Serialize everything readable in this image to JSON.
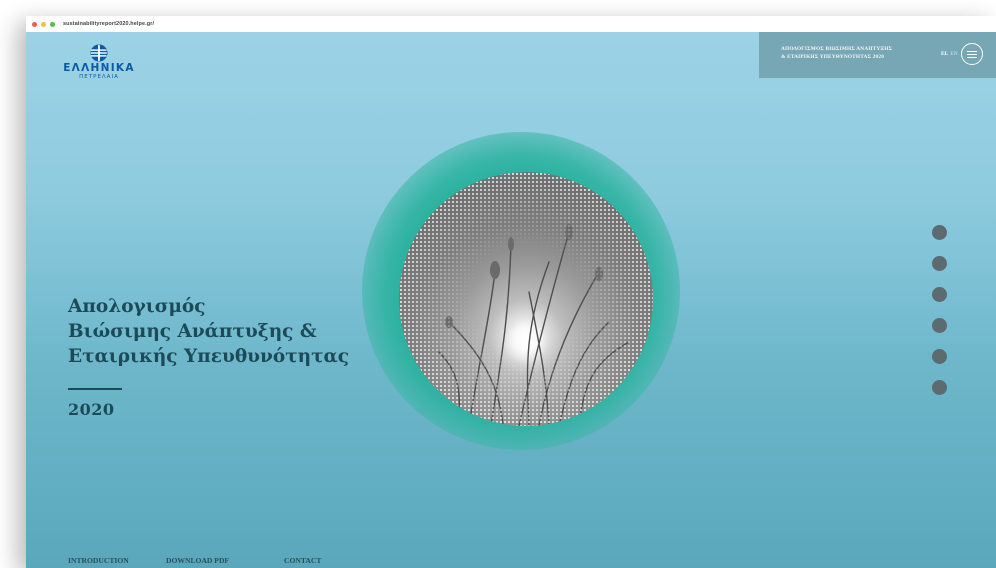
{
  "browser": {
    "url": "sustainabilityreport2020.helpe.gr/"
  },
  "logo": {
    "title": "ΕΛΛΗΝΙΚΑ",
    "subtitle": "ΠΕΤΡΕΛΑΙΑ",
    "icon": "helpe-logo-icon"
  },
  "header": {
    "title_line1": "ΑΠΟΛΟΓΙΣΜΟΣ ΒΙΩΣΙΜΗΣ ΑΝΑΠΤΥΞΗΣ",
    "title_line2": "& ΕΤΑΙΡΙΚΗΣ ΥΠΕΥΘΥΝΟΤΗΤΑΣ 2020",
    "lang_active": "EL",
    "lang_inactive": "EN",
    "menu_icon": "hamburger-menu-icon"
  },
  "hero": {
    "line1": "Απολογισμός",
    "line2": "Βιώσιμης Ανάπτυξης &",
    "line3": "Εταιρικής Υπευθυνότητας",
    "year": "2020"
  },
  "section_nav": {
    "count": 6,
    "color": "#5b6b70"
  },
  "footer": {
    "links": [
      "INTRODUCTION",
      "DOWNLOAD PDF",
      "CONTACT"
    ]
  },
  "colors": {
    "heading": "#1c4a58",
    "logo_blue": "#0b5aa6",
    "teal": "#20b09a",
    "header_panel": "#77a7b4"
  }
}
